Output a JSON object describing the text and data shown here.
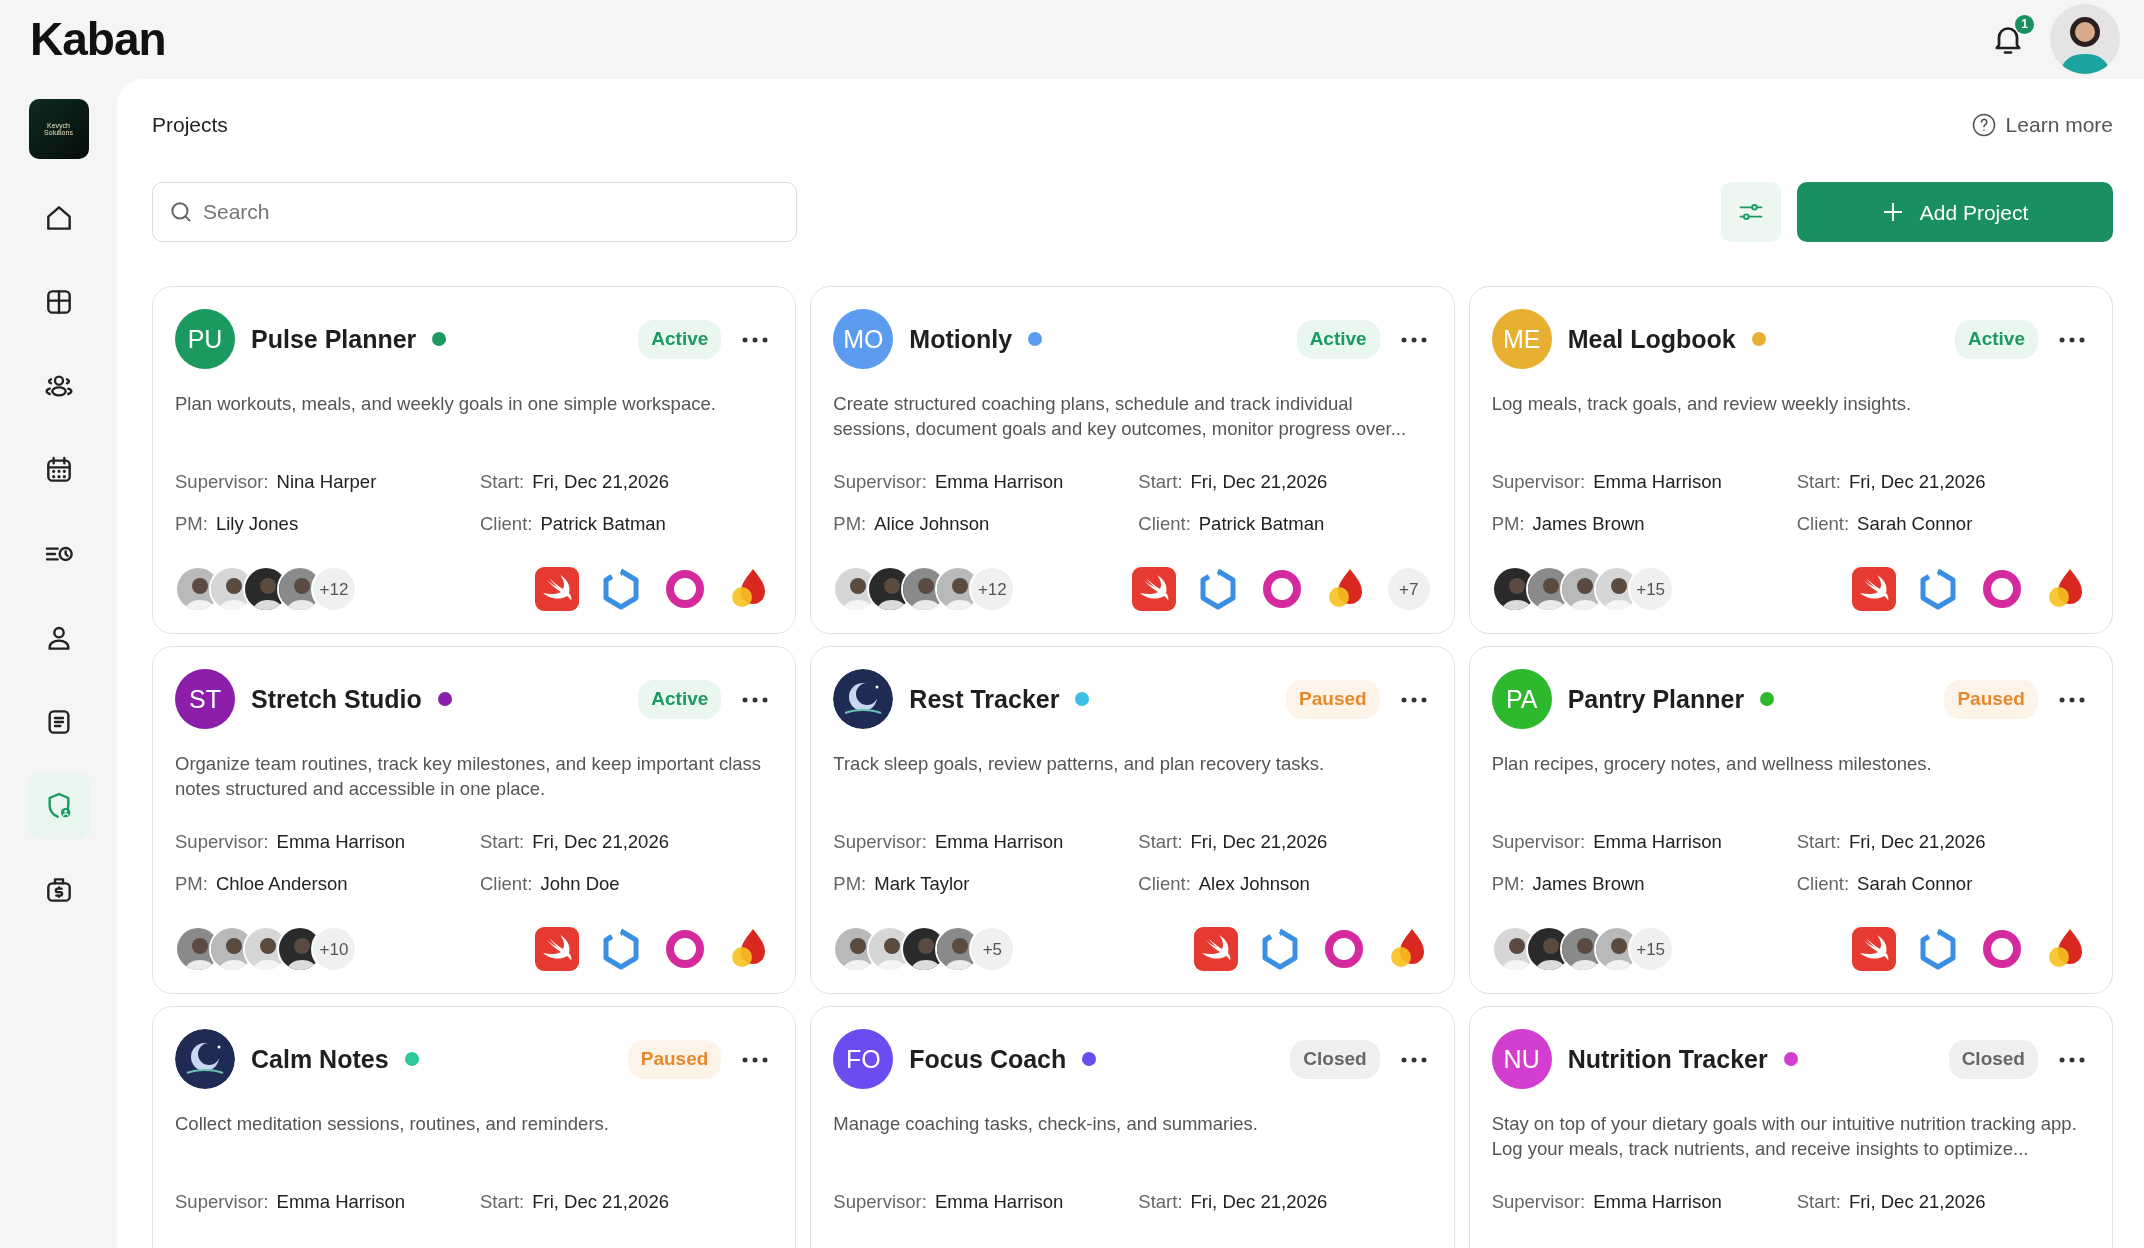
{
  "app": {
    "logo": "Kaban",
    "notifications": "1"
  },
  "sidebar": {
    "workspace": "Kevych Solutions",
    "items": [
      {
        "kind": "home",
        "selected": false
      },
      {
        "kind": "layout",
        "selected": false
      },
      {
        "kind": "team",
        "selected": false
      },
      {
        "kind": "calendar",
        "selected": false
      },
      {
        "kind": "schedule",
        "selected": false
      },
      {
        "kind": "user",
        "selected": false
      },
      {
        "kind": "document",
        "selected": false
      },
      {
        "kind": "shield",
        "selected": true
      },
      {
        "kind": "money",
        "selected": false
      }
    ]
  },
  "header": {
    "title": "Projects",
    "help": "Learn more"
  },
  "search": {
    "placeholder": "Search"
  },
  "add_button": "Add Project",
  "projects": [
    {
      "initials": "PU",
      "name": "Pulse Planner",
      "color": "#1a9a5e",
      "status": "Active",
      "description": "Plan workouts, meals, and weekly goals in one simple workspace.",
      "supervisor_label": "Supervisor:",
      "supervisor": "Nina Harper",
      "start_label": "Start:",
      "start": "Fri, Dec 21,2026",
      "pm_label": "PM:",
      "pm": "Lily Jones",
      "client_label": "Client:",
      "client": "Patrick Batman",
      "members_more": "+12",
      "tech": [
        {
          "kind": "swift"
        },
        {
          "kind": "hexagon"
        },
        {
          "kind": "swirl"
        },
        {
          "kind": "flame"
        }
      ]
    },
    {
      "initials": "MO",
      "name": "Motionly",
      "color": "#5b9cf0",
      "status": "Active",
      "description": "Create structured coaching plans, schedule and track individual sessions, document goals and key outcomes, monitor progress over...",
      "supervisor_label": "Supervisor:",
      "supervisor": "Emma Harrison",
      "start_label": "Start:",
      "start": "Fri, Dec 21,2026",
      "pm_label": "PM:",
      "pm": "Alice Johnson",
      "client_label": "Client:",
      "client": "Patrick Batman",
      "members_more": "+12",
      "tech": [
        {
          "kind": "swift"
        },
        {
          "kind": "hexagon"
        },
        {
          "kind": "swirl"
        },
        {
          "kind": "flame"
        }
      ],
      "tech_more": "+7"
    },
    {
      "initials": "ME",
      "name": "Meal Logbook",
      "color": "#e8b030",
      "status": "Active",
      "description": "Log meals, track goals, and review weekly insights.",
      "supervisor_label": "Supervisor:",
      "supervisor": "Emma Harrison",
      "start_label": "Start:",
      "start": "Fri, Dec 21,2026",
      "pm_label": "PM:",
      "pm": "James Brown",
      "client_label": "Client:",
      "client": "Sarah Connor",
      "members_more": "+15",
      "tech": [
        {
          "kind": "swift"
        },
        {
          "kind": "hexagon"
        },
        {
          "kind": "swirl"
        },
        {
          "kind": "flame"
        }
      ]
    },
    {
      "initials": "ST",
      "name": "Stretch Studio",
      "color": "#8b1fa9",
      "status": "Active",
      "description": "Organize team routines, track key milestones, and keep important class notes structured and accessible in one place.",
      "supervisor_label": "Supervisor:",
      "supervisor": "Emma Harrison",
      "start_label": "Start:",
      "start": "Fri, Dec 21,2026",
      "pm_label": "PM:",
      "pm": "Chloe Anderson",
      "client_label": "Client:",
      "client": "John Doe",
      "members_more": "+10",
      "tech": [
        {
          "kind": "swift"
        },
        {
          "kind": "hexagon"
        },
        {
          "kind": "swirl"
        },
        {
          "kind": "flame"
        }
      ]
    },
    {
      "kind": "picture",
      "name": "Rest Tracker",
      "color": "#3cc0e8",
      "status": "Paused",
      "description": "Track sleep goals, review patterns, and plan recovery tasks.",
      "supervisor_label": "Supervisor:",
      "supervisor": "Emma Harrison",
      "start_label": "Start:",
      "start": "Fri, Dec 21,2026",
      "pm_label": "PM:",
      "pm": "Mark Taylor",
      "client_label": "Client:",
      "client": "Alex Johnson",
      "members_more": "+5",
      "tech": [
        {
          "kind": "swift"
        },
        {
          "kind": "hexagon"
        },
        {
          "kind": "swirl"
        },
        {
          "kind": "flame"
        }
      ]
    },
    {
      "initials": "PA",
      "name": "Pantry Planner",
      "color": "#2eb82e",
      "status": "Paused",
      "description": "Plan recipes, grocery notes, and wellness milestones.",
      "supervisor_label": "Supervisor:",
      "supervisor": "Emma Harrison",
      "start_label": "Start:",
      "start": "Fri, Dec 21,2026",
      "pm_label": "PM:",
      "pm": "James Brown",
      "client_label": "Client:",
      "client": "Sarah Connor",
      "members_more": "+15",
      "tech": [
        {
          "kind": "swift"
        },
        {
          "kind": "hexagon"
        },
        {
          "kind": "swirl"
        },
        {
          "kind": "flame"
        }
      ]
    },
    {
      "kind": "picture",
      "name": "Calm Notes",
      "color": "#2ec99a",
      "status": "Paused",
      "description": "Collect meditation sessions, routines, and reminders.",
      "supervisor_label": "Supervisor:",
      "supervisor": "Emma Harrison",
      "start_label": "Start:",
      "start": "Fri, Dec 21,2026"
    },
    {
      "initials": "FO",
      "name": "Focus Coach",
      "color": "#6a4cf0",
      "status": "Closed",
      "description": "Manage coaching tasks, check-ins, and summaries.",
      "supervisor_label": "Supervisor:",
      "supervisor": "Emma Harrison",
      "start_label": "Start:",
      "start": "Fri, Dec 21,2026"
    },
    {
      "initials": "NU",
      "name": "Nutrition Tracker",
      "color": "#d23fd0",
      "status": "Closed",
      "description": "Stay on top of your dietary goals with our intuitive nutrition tracking app. Log your meals, track nutrients, and receive insights to optimize...",
      "supervisor_label": "Supervisor:",
      "supervisor": "Emma Harrison",
      "start_label": "Start:",
      "start": "Fri, Dec 21,2026"
    }
  ]
}
